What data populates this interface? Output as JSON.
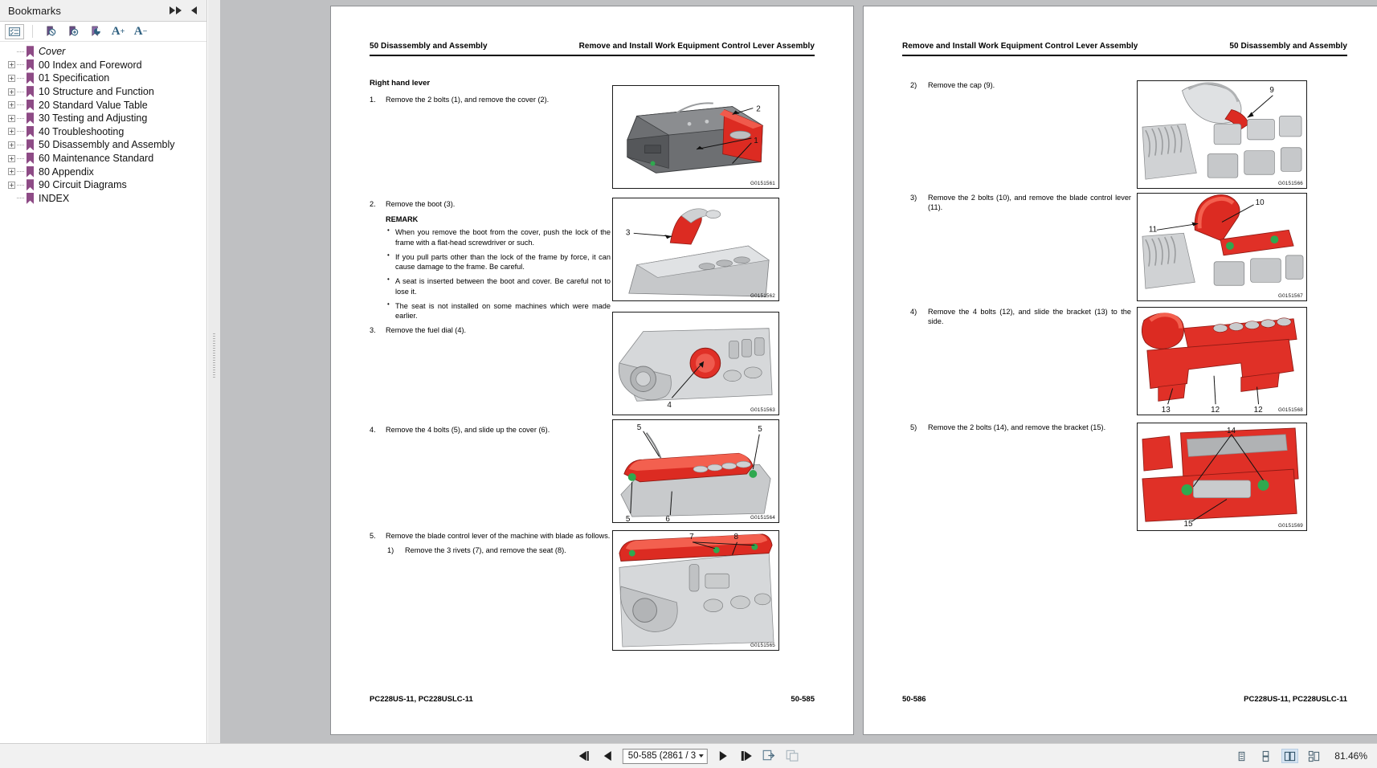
{
  "bookmarks_panel": {
    "title": "Bookmarks",
    "toolbar": [
      {
        "name": "bookmark-options-icon",
        "glyph": "☰"
      },
      {
        "name": "delete-bookmark-icon",
        "glyph": "ⓧ"
      },
      {
        "name": "add-bookmark-icon",
        "glyph": "⊕"
      },
      {
        "name": "find-bookmark-icon",
        "glyph": "◔"
      },
      {
        "name": "increase-text-size-icon",
        "glyph": "A"
      },
      {
        "name": "decrease-text-size-icon",
        "glyph": "A"
      }
    ],
    "collapse_label": "▶▶",
    "expand_label": "◀",
    "items": [
      {
        "label": "Cover",
        "expandable": false,
        "italic": true
      },
      {
        "label": "00 Index and Foreword",
        "expandable": true,
        "italic": false
      },
      {
        "label": "01 Specification",
        "expandable": true,
        "italic": false
      },
      {
        "label": "10 Structure and Function",
        "expandable": true,
        "italic": false
      },
      {
        "label": "20 Standard Value Table",
        "expandable": true,
        "italic": false
      },
      {
        "label": "30 Testing and Adjusting",
        "expandable": true,
        "italic": false
      },
      {
        "label": "40 Troubleshooting",
        "expandable": true,
        "italic": false
      },
      {
        "label": "50 Disassembly and Assembly",
        "expandable": true,
        "italic": false
      },
      {
        "label": "60 Maintenance Standard",
        "expandable": true,
        "italic": false
      },
      {
        "label": "80 Appendix",
        "expandable": true,
        "italic": false
      },
      {
        "label": "90 Circuit Diagrams",
        "expandable": true,
        "italic": false
      },
      {
        "label": "INDEX",
        "expandable": false,
        "italic": false
      }
    ],
    "expander_plus": "+"
  },
  "left_page": {
    "header_left": "50 Disassembly and Assembly",
    "header_right": "Remove and Install Work Equipment Control Lever Assembly",
    "section_title": "Right hand lever",
    "steps": [
      {
        "num": "1.",
        "text": "Remove the 2 bolts (1), and remove the cover (2)."
      },
      {
        "num": "2.",
        "text": "Remove the boot (3)."
      },
      {
        "num": "3.",
        "text": "Remove the fuel dial (4)."
      },
      {
        "num": "4.",
        "text": "Remove the 4 bolts (5), and slide up the cover (6)."
      },
      {
        "num": "5.",
        "text": "Remove the blade control lever of the machine with blade as follows."
      }
    ],
    "remark_title": "REMARK",
    "remark_bullets": [
      "When you remove the boot from the cover, push the lock of the frame with a flat-head screwdriver or such.",
      "If you pull parts other than the lock of the frame by force, it can cause damage to the frame. Be careful.",
      "A seat is inserted between the boot and cover. Be careful not to lose it.",
      "The seat is not installed on some machines which were made earlier."
    ],
    "sub_step": {
      "num": "1)",
      "text": "Remove the 3 rivets (7), and remove the seat (8)."
    },
    "figures": [
      {
        "id": "G0151561",
        "callouts": [
          "2",
          "1"
        ]
      },
      {
        "id": "G0151562",
        "callouts": [
          "3"
        ]
      },
      {
        "id": "G0151563",
        "callouts": [
          "4"
        ]
      },
      {
        "id": "G0151564",
        "callouts": [
          "5",
          "5",
          "5",
          "6"
        ]
      },
      {
        "id": "G0151565",
        "callouts": [
          "7",
          "8"
        ]
      }
    ],
    "footer_left": "PC228US-11, PC228USLC-11",
    "footer_right": "50-585"
  },
  "right_page": {
    "header_left": "Remove and Install Work Equipment Control Lever Assembly",
    "header_right": "50 Disassembly and Assembly",
    "steps": [
      {
        "num": "2)",
        "text": "Remove the cap (9)."
      },
      {
        "num": "3)",
        "text": "Remove the 2 bolts (10), and remove the blade control lever (11)."
      },
      {
        "num": "4)",
        "text": "Remove the 4 bolts (12), and slide the bracket (13) to the side."
      },
      {
        "num": "5)",
        "text": "Remove the 2 bolts (14), and remove the bracket (15)."
      }
    ],
    "figures": [
      {
        "id": "G0151566",
        "callouts": [
          "9"
        ]
      },
      {
        "id": "G0151567",
        "callouts": [
          "10",
          "11"
        ]
      },
      {
        "id": "G0151568",
        "callouts": [
          "13",
          "12",
          "12"
        ]
      },
      {
        "id": "G0151569",
        "callouts": [
          "14",
          "15"
        ]
      }
    ],
    "footer_left": "50-586",
    "footer_right": "PC228US-11, PC228USLC-11"
  },
  "bottom_bar": {
    "first_page_label": "first-page",
    "previous_page_label": "previous-page",
    "page_value": "50-585 (2861 / 3",
    "next_page_label": "next-page",
    "last_page_label": "last-page",
    "zoom_value": "81.46%",
    "view_modes": [
      {
        "name": "single-page-view",
        "active": false
      },
      {
        "name": "continuous-scroll-view",
        "active": false
      },
      {
        "name": "two-page-view",
        "active": true
      },
      {
        "name": "two-page-scroll-view",
        "active": false
      }
    ]
  },
  "colors": {
    "accent_red": "#e8241f",
    "bookmark_purple": "#8e4b86",
    "viewer_bg": "#bfc0c2",
    "panel_bg": "#f0f0f0",
    "active_blue": "#d6e4f2"
  }
}
